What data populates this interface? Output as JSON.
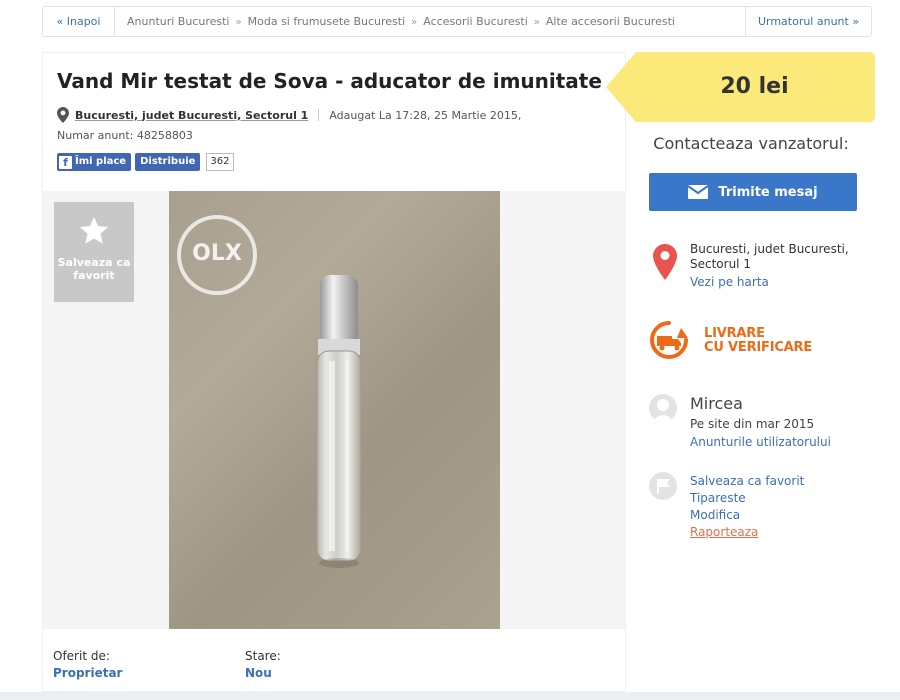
{
  "breadcrumb": {
    "back_label": "« Inapoi",
    "items": [
      "Anunturi Bucuresti",
      "Moda si frumusete Bucuresti",
      "Accesorii Bucuresti",
      "Alte accesorii Bucuresti"
    ],
    "separator": "»",
    "next_label": "Urmatorul anunt »"
  },
  "ad": {
    "title": "Vand Mir testat de Sova - aducator de imunitate",
    "location": "Bucuresti, judet Bucuresti, Sectorul 1",
    "added": "Adaugat La 17:28, 25 Martie 2015,",
    "ad_number": "Numar anunt: 48258803",
    "social": {
      "like_label": "Îmi place",
      "share_label": "Distribuie",
      "share_count": "362"
    },
    "favorite_label": "Salveaza ca favorit",
    "watermark": "OLX",
    "offered_by_label": "Oferit de:",
    "offered_by_value": "Proprietar",
    "condition_label": "Stare:",
    "condition_value": "Nou"
  },
  "sidebar": {
    "price": "20 lei",
    "contact_title": "Contacteaza vanzatorul:",
    "message_button": "Trimite mesaj",
    "location_line1": "Bucuresti, judet Bucuresti,",
    "location_line2": "Sectorul 1",
    "map_link": "Vezi pe harta",
    "delivery_line1": "LIVRARE",
    "delivery_line2": "CU VERIFICARE",
    "seller_name": "Mircea",
    "seller_since": "Pe site din mar 2015",
    "seller_ads_link": "Anunturile utilizatorului",
    "actions": [
      "Salveaza ca favorit",
      "Tipareste",
      "Modifica",
      "Raporteaza"
    ]
  },
  "colors": {
    "link": "#3c6fb4",
    "price_tag": "#fbe97a",
    "message_button": "#3a77c9",
    "delivery": "#ef6a17",
    "facebook": "#4267b2"
  }
}
